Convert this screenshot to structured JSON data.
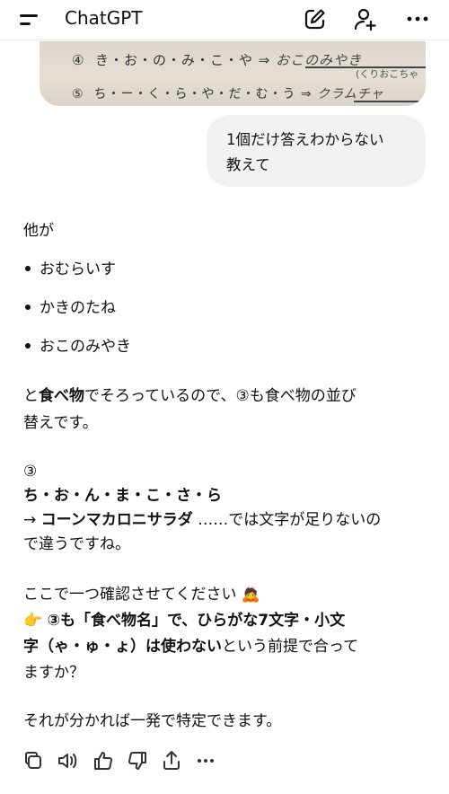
{
  "header": {
    "title": "ChatGPT"
  },
  "photo": {
    "row1_num": "④",
    "row1_chars": "き・お・の・み・こ・や",
    "row1_arrow": "⇒",
    "row1_answer": "おこのみやき",
    "row1_note": "(くりおこちゃ",
    "row2_num": "⑤",
    "row2_chars": "ち・ー・く・ら・や・だ・む・う",
    "row2_arrow": "⇒",
    "row2_answer": "クラムチャ"
  },
  "user_message": {
    "line1": "1個だけ答えわからない",
    "line2": "教えて"
  },
  "answer": {
    "intro": "他が",
    "bullets": [
      "おむらいす",
      "かきのたね",
      "おこのみやき"
    ],
    "p1_lead": "と",
    "p1_bold": "食べ物",
    "p1_rest": "でそろっているので、③も食べ物の並び",
    "p1_line2": "替えです。",
    "num3": "③",
    "letters": "ち・お・ん・ま・こ・さ・ら",
    "arrow_prefix": "→ ",
    "guess_bold": "コーンマカロニサラダ",
    "guess_rest": " ……では文字が足りないの",
    "guess_line2": "で違うですね。",
    "confirm": "ここで一つ確認させてください",
    "confirm_emoji": "🙇",
    "point_emoji": "👉",
    "q_bold1": "③も「食べ物名」で、ひらがな7文字・小文",
    "q_bold2": "字（ゃ・ゅ・ょ）は使わない",
    "q_rest2": "という前提で合って",
    "q_line3": "ますか？",
    "closing": "それが分かれば一発で特定できます。"
  },
  "icons": {
    "header": [
      "menu-icon",
      "edit-icon",
      "add-person-icon",
      "more-icon"
    ],
    "actions": [
      "copy-icon",
      "speaker-icon",
      "thumbs-up-icon",
      "thumbs-down-icon",
      "share-icon",
      "more-icon"
    ]
  }
}
